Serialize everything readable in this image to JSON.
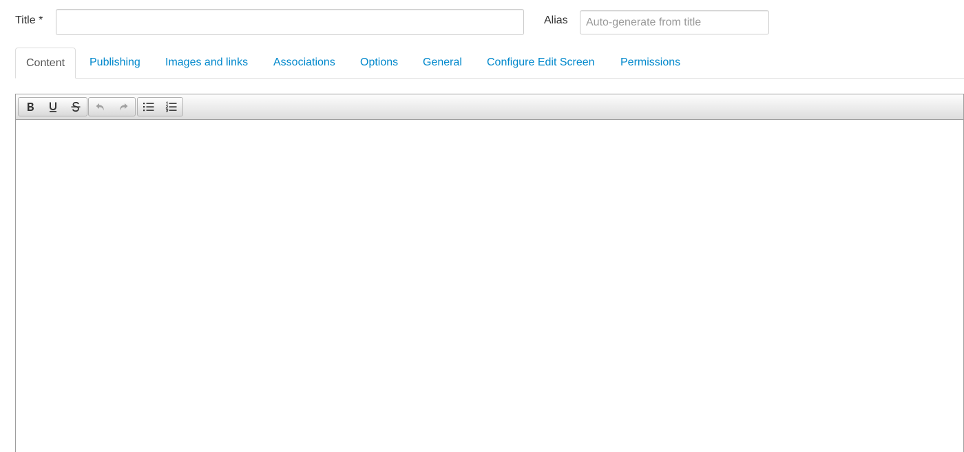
{
  "form": {
    "title_label": "Title *",
    "title_value": "",
    "alias_label": "Alias",
    "alias_placeholder": "Auto-generate from title",
    "alias_value": ""
  },
  "tabs": [
    {
      "label": "Content",
      "active": true
    },
    {
      "label": "Publishing",
      "active": false
    },
    {
      "label": "Images and links",
      "active": false
    },
    {
      "label": "Associations",
      "active": false
    },
    {
      "label": "Options",
      "active": false
    },
    {
      "label": "General",
      "active": false
    },
    {
      "label": "Configure Edit Screen",
      "active": false
    },
    {
      "label": "Permissions",
      "active": false
    }
  ],
  "editor": {
    "toolbar": {
      "buttons": [
        {
          "icon": "bold-icon"
        },
        {
          "icon": "underline-icon"
        },
        {
          "icon": "strikethrough-icon"
        },
        {
          "icon": "undo-icon"
        },
        {
          "icon": "redo-icon"
        },
        {
          "icon": "bullet-list-icon"
        },
        {
          "icon": "numbered-list-icon"
        }
      ]
    },
    "content": ""
  },
  "colors": {
    "link": "#0088cc",
    "text": "#333333",
    "border": "#dddddd",
    "placeholder": "#999999"
  }
}
